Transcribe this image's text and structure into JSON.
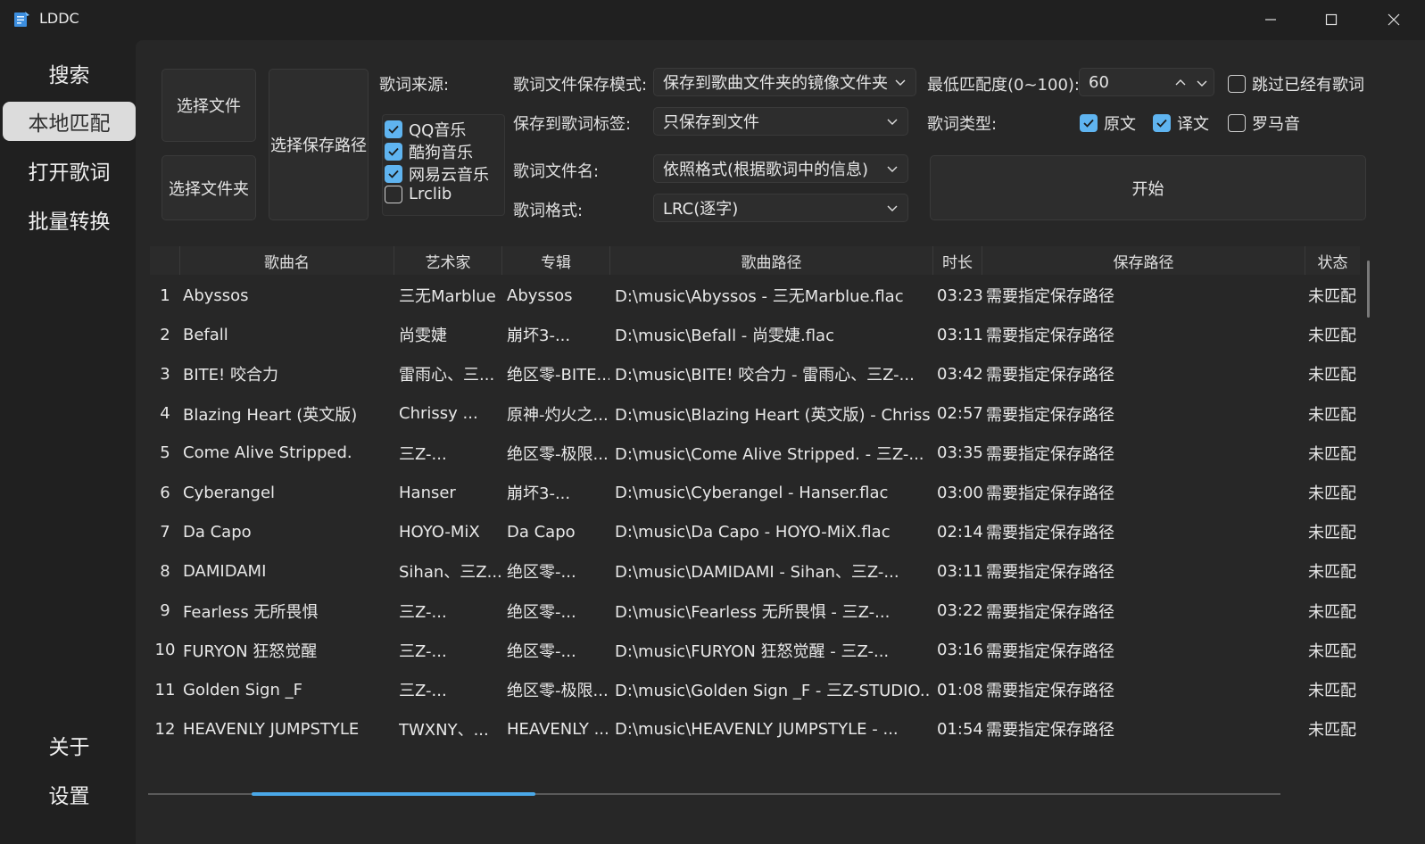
{
  "window": {
    "title": "LDDC",
    "icon": "lddc-logo-icon"
  },
  "sidebar": {
    "top_items": [
      {
        "label": "搜索",
        "active": false
      },
      {
        "label": "本地匹配",
        "active": true
      },
      {
        "label": "打开歌词",
        "active": false
      },
      {
        "label": "批量转换",
        "active": false
      }
    ],
    "bottom_items": [
      {
        "label": "关于"
      },
      {
        "label": "设置"
      }
    ]
  },
  "controls": {
    "select_file": "选择文件",
    "select_folder": "选择文件夹",
    "select_save_path": "选择保存路径",
    "lyrics_source_label": "歌词来源:",
    "sources": [
      {
        "label": "QQ音乐",
        "checked": true
      },
      {
        "label": "酷狗音乐",
        "checked": true
      },
      {
        "label": "网易云音乐",
        "checked": true
      },
      {
        "label": "Lrclib",
        "checked": false
      }
    ],
    "save_mode_label": "歌词文件保存模式:",
    "save_mode_value": "保存到歌曲文件夹的镜像文件夹",
    "save_tag_label": "保存到歌词标签:",
    "save_tag_value": "只保存到文件",
    "filename_label": "歌词文件名:",
    "filename_value": "依照格式(根据歌词中的信息)",
    "format_label": "歌词格式:",
    "format_value": "LRC(逐字)",
    "min_match_label": "最低匹配度(0~100):",
    "min_match_value": "60",
    "skip_existing_label": "跳过已经有歌词",
    "skip_existing_checked": false,
    "lyrics_type_label": "歌词类型:",
    "lyrics_types": [
      {
        "label": "原文",
        "checked": true
      },
      {
        "label": "译文",
        "checked": true
      },
      {
        "label": "罗马音",
        "checked": false
      }
    ],
    "start": "开始"
  },
  "table": {
    "headers": [
      "歌曲名",
      "艺术家",
      "专辑",
      "歌曲路径",
      "时长",
      "保存路径",
      "状态"
    ],
    "rows": [
      {
        "n": "1",
        "song": "Abyssos",
        "artist": "三无Marblue",
        "album": "Abyssos",
        "path": "D:\\music\\Abyssos - 三无Marblue.flac",
        "dur": "03:23",
        "save": "需要指定保存路径",
        "status": "未匹配"
      },
      {
        "n": "2",
        "song": "Befall",
        "artist": "尚雯婕",
        "album": "崩坏3-...",
        "path": "D:\\music\\Befall - 尚雯婕.flac",
        "dur": "03:11",
        "save": "需要指定保存路径",
        "status": "未匹配"
      },
      {
        "n": "3",
        "song": "BITE! 咬合力",
        "artist": "雷雨心、三...",
        "album": "绝区零-BITE...",
        "path": "D:\\music\\BITE! 咬合力 - 雷雨心、三Z-...",
        "dur": "03:42",
        "save": "需要指定保存路径",
        "status": "未匹配"
      },
      {
        "n": "4",
        "song": "Blazing Heart (英文版)",
        "artist": "Chrissy ...",
        "album": "原神-灼火之...",
        "path": "D:\\music\\Blazing Heart (英文版) - Chriss...",
        "dur": "02:57",
        "save": "需要指定保存路径",
        "status": "未匹配"
      },
      {
        "n": "5",
        "song": "Come Alive Stripped.",
        "artist": "三Z-...",
        "album": "绝区零-极限...",
        "path": "D:\\music\\Come Alive Stripped. - 三Z-...",
        "dur": "03:35",
        "save": "需要指定保存路径",
        "status": "未匹配"
      },
      {
        "n": "6",
        "song": "Cyberangel",
        "artist": "Hanser",
        "album": "崩坏3-...",
        "path": "D:\\music\\Cyberangel - Hanser.flac",
        "dur": "03:00",
        "save": "需要指定保存路径",
        "status": "未匹配"
      },
      {
        "n": "7",
        "song": "Da Capo",
        "artist": "HOYO-MiX",
        "album": "Da Capo",
        "path": "D:\\music\\Da Capo - HOYO-MiX.flac",
        "dur": "02:14",
        "save": "需要指定保存路径",
        "status": "未匹配"
      },
      {
        "n": "8",
        "song": "DAMIDAMI",
        "artist": "Sihan、三Z...",
        "album": "绝区零-...",
        "path": "D:\\music\\DAMIDAMI - Sihan、三Z-...",
        "dur": "03:11",
        "save": "需要指定保存路径",
        "status": "未匹配"
      },
      {
        "n": "9",
        "song": "Fearless 无所畏惧",
        "artist": "三Z-...",
        "album": "绝区零-...",
        "path": "D:\\music\\Fearless 无所畏惧 - 三Z-...",
        "dur": "03:22",
        "save": "需要指定保存路径",
        "status": "未匹配"
      },
      {
        "n": "10",
        "song": "FURYON 狂怒觉醒",
        "artist": "三Z-...",
        "album": "绝区零-...",
        "path": "D:\\music\\FURYON 狂怒觉醒 - 三Z-...",
        "dur": "03:16",
        "save": "需要指定保存路径",
        "status": "未匹配"
      },
      {
        "n": "11",
        "song": "Golden Sign _F",
        "artist": "三Z-...",
        "album": "绝区零-极限...",
        "path": "D:\\music\\Golden Sign _F - 三Z-STUDIO...",
        "dur": "01:08",
        "save": "需要指定保存路径",
        "status": "未匹配"
      },
      {
        "n": "12",
        "song": "HEAVENLY JUMPSTYLE",
        "artist": "TWXNY、...",
        "album": "HEAVENLY ...",
        "path": "D:\\music\\HEAVENLY JUMPSTYLE - ...",
        "dur": "01:54",
        "save": "需要指定保存路径",
        "status": "未匹配"
      }
    ]
  },
  "colors": {
    "accent": "#5fb4f0",
    "background": "#202020",
    "panel": "#272727"
  }
}
